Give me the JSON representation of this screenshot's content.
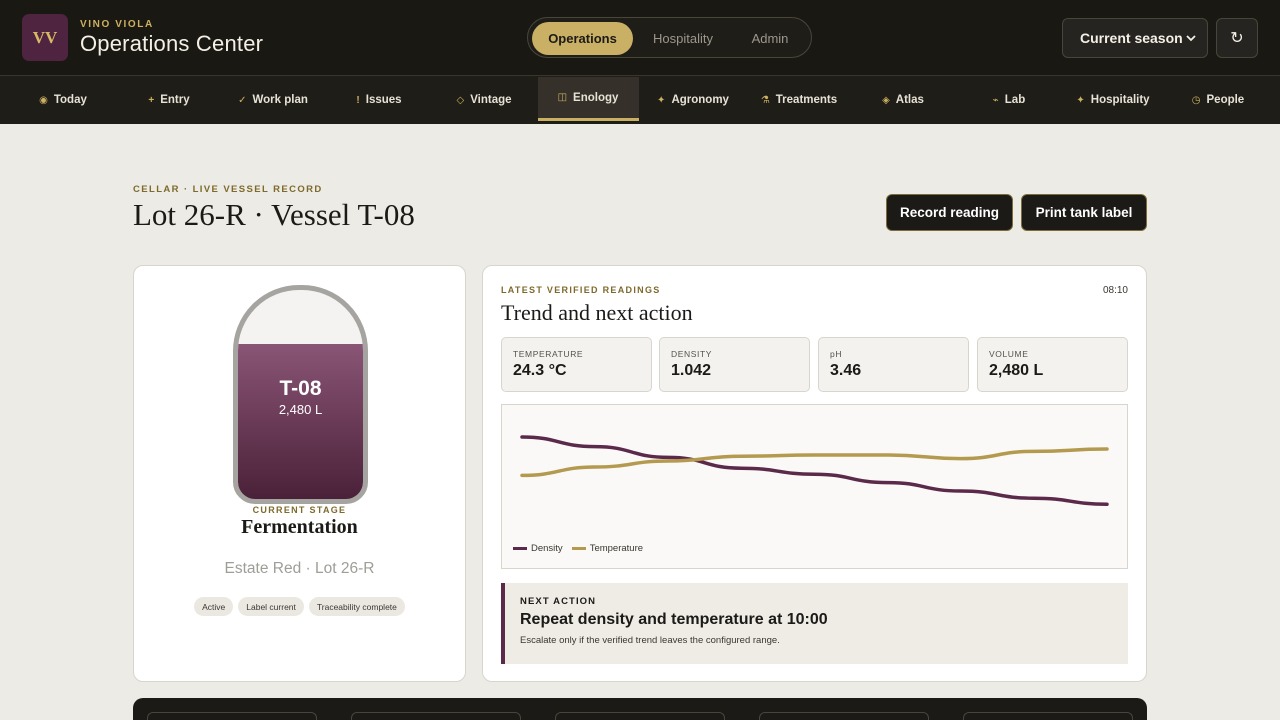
{
  "brand": {
    "logo_text": "VV",
    "kicker": "VINO VIOLA",
    "title": "Operations Center"
  },
  "modes": [
    {
      "label": "Operations",
      "active": true
    },
    {
      "label": "Hospitality",
      "active": false
    },
    {
      "label": "Admin",
      "active": false
    }
  ],
  "season": {
    "selected": "Current season"
  },
  "refresh": {
    "glyph": "↻"
  },
  "nav": [
    {
      "label": "Today",
      "icon": "◉",
      "icon_name": "today-icon"
    },
    {
      "label": "Entry",
      "icon": "+",
      "icon_name": "plus-icon"
    },
    {
      "label": "Work plan",
      "icon": "✓",
      "icon_name": "check-icon"
    },
    {
      "label": "Issues",
      "icon": "!",
      "icon_name": "alert-icon"
    },
    {
      "label": "Vintage",
      "icon": "◇",
      "icon_name": "diamond-outline-icon"
    },
    {
      "label": "Enology",
      "icon": "◫",
      "icon_name": "tank-icon",
      "active": true
    },
    {
      "label": "Agronomy",
      "icon": "✦",
      "icon_name": "sparkle-icon"
    },
    {
      "label": "Treatments",
      "icon": "⚗",
      "icon_name": "flask-icon"
    },
    {
      "label": "Atlas",
      "icon": "◈",
      "icon_name": "map-icon"
    },
    {
      "label": "Lab",
      "icon": "⌁",
      "icon_name": "lab-icon"
    },
    {
      "label": "Hospitality",
      "icon": "✦",
      "icon_name": "star-icon"
    },
    {
      "label": "People",
      "icon": "◷",
      "icon_name": "people-icon"
    }
  ],
  "header": {
    "kicker": "CELLAR · LIVE VESSEL RECORD",
    "title": "Lot 26-R · Vessel T-08",
    "record_button": "Record reading",
    "print_button": "Print tank label"
  },
  "vessel": {
    "id": "T-08",
    "volume": "2,480 L",
    "fill_fraction": 0.74,
    "stage_label": "CURRENT STAGE",
    "stage": "Fermentation",
    "lot_line": "Estate Red · Lot 26-R",
    "chips": [
      "Active",
      "Label current",
      "Traceability complete"
    ]
  },
  "readings": {
    "kicker": "LATEST VERIFIED READINGS",
    "time": "08:10",
    "title": "Trend and next action",
    "metrics": [
      {
        "label": "TEMPERATURE",
        "value": "24.3 °C"
      },
      {
        "label": "DENSITY",
        "value": "1.042"
      },
      {
        "label": "pH",
        "value": "3.46"
      },
      {
        "label": "VOLUME",
        "value": "2,480 L"
      }
    ]
  },
  "chart_data": {
    "type": "line",
    "title": "",
    "xlabel": "",
    "ylabel": "",
    "grid": false,
    "legend": "bottom-left",
    "x": [
      0,
      1,
      2,
      3,
      4,
      5,
      6,
      7,
      8
    ],
    "ylim": [
      0,
      1
    ],
    "series": [
      {
        "name": "Density",
        "color": "#5b2a4a",
        "values": [
          0.8,
          0.72,
          0.63,
          0.54,
          0.49,
          0.42,
          0.35,
          0.29,
          0.24
        ]
      },
      {
        "name": "Temperature",
        "color": "#b39a4e",
        "values": [
          0.48,
          0.55,
          0.6,
          0.64,
          0.65,
          0.65,
          0.62,
          0.68,
          0.7
        ]
      }
    ]
  },
  "next_action": {
    "kicker": "NEXT ACTION",
    "title": "Repeat density and temperature at 10:00",
    "detail": "Escalate only if the verified trend leaves the configured range."
  }
}
